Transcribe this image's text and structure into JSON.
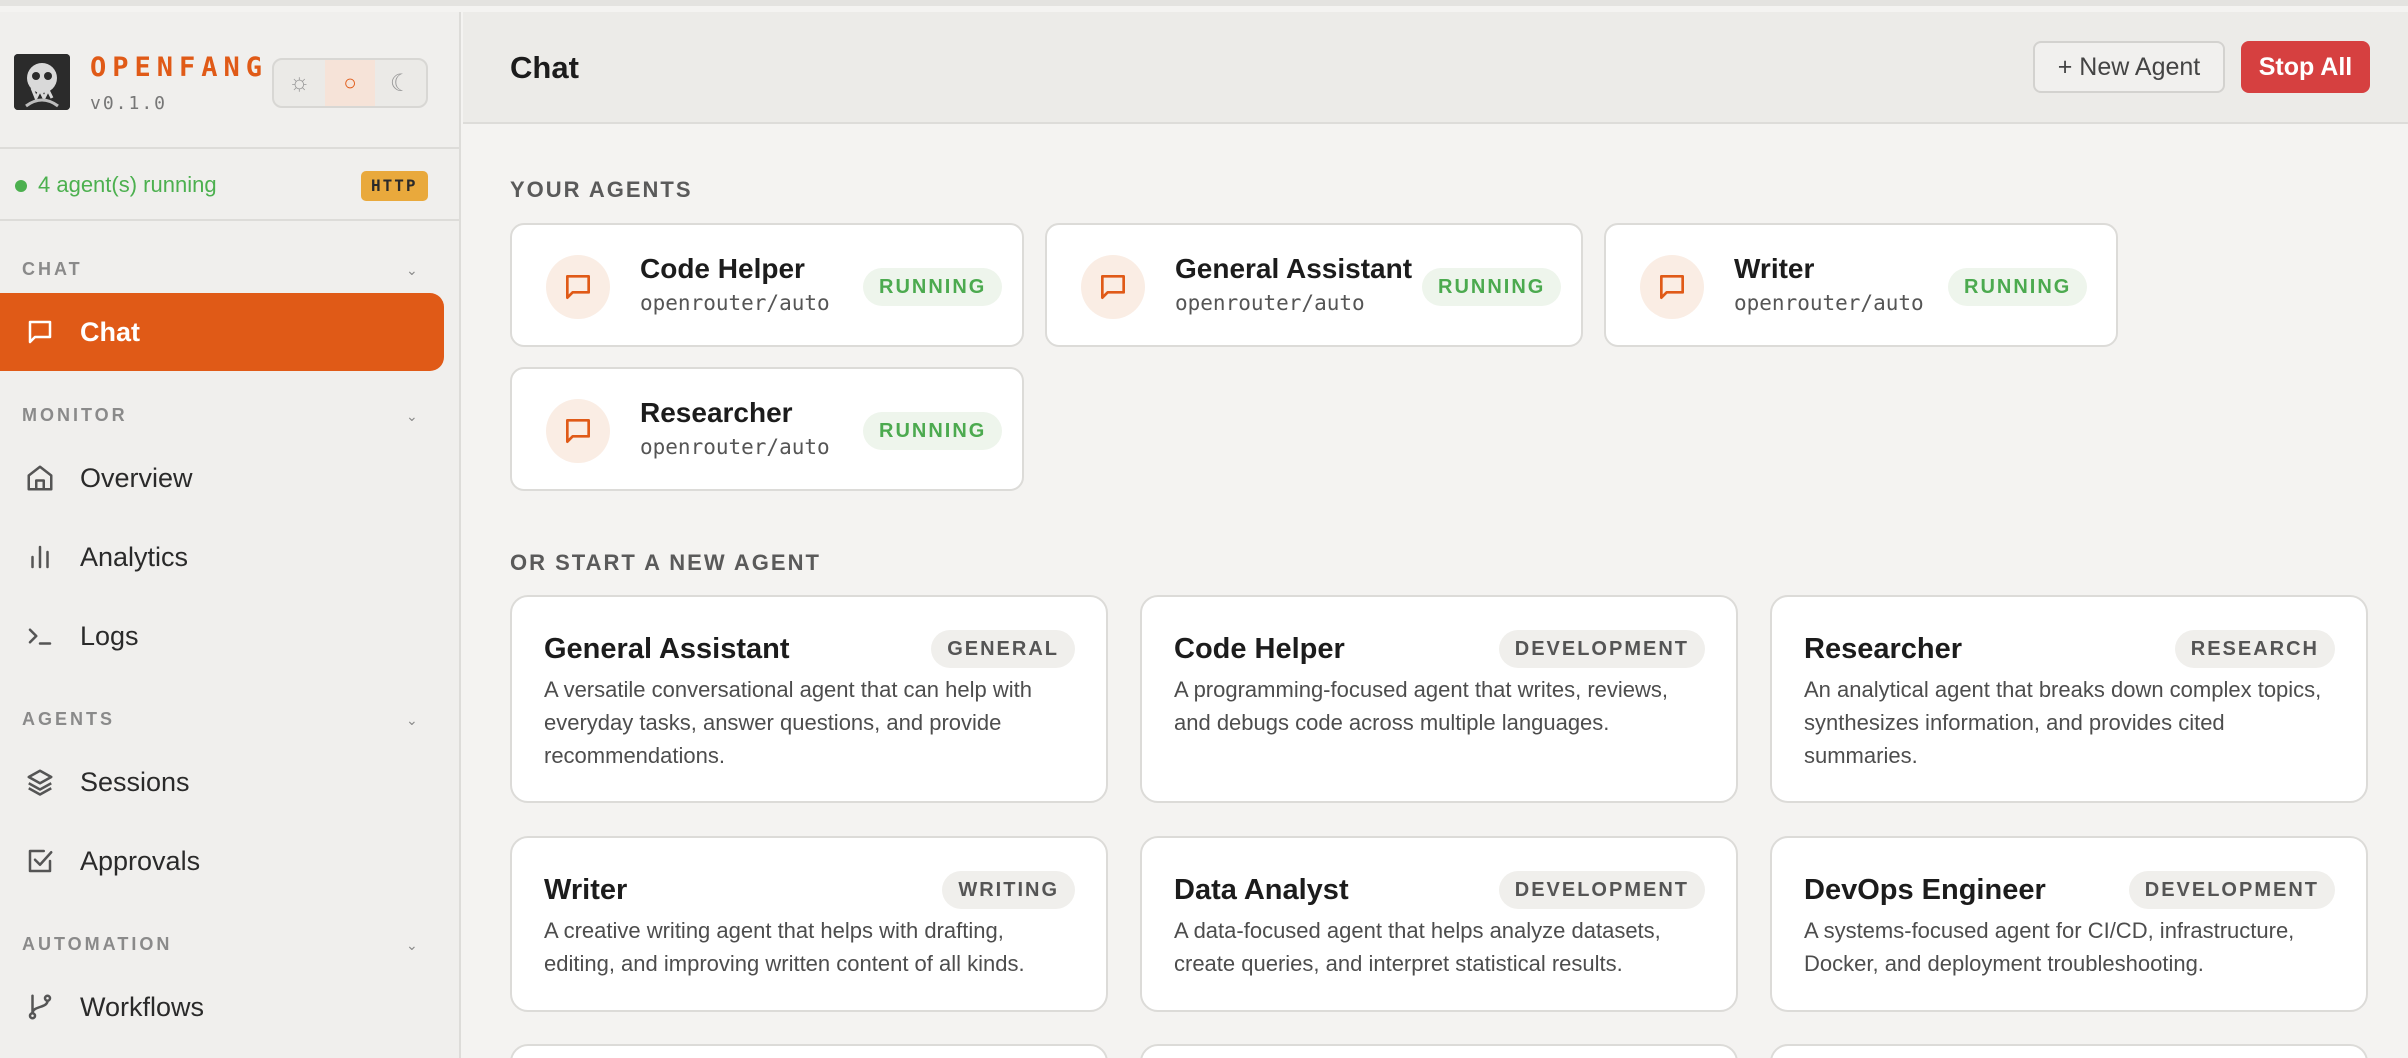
{
  "brand": {
    "name": "OPENFANG",
    "version": "v0.1.0"
  },
  "theme": {
    "light": "☼",
    "system": "○",
    "dark": "☾"
  },
  "status": {
    "text": "4 agent(s) running",
    "badge": "HTTP"
  },
  "sidebar": {
    "sections": [
      {
        "label": "CHAT",
        "items": [
          {
            "label": "Chat",
            "icon": "chat-icon"
          }
        ]
      },
      {
        "label": "MONITOR",
        "items": [
          {
            "label": "Overview",
            "icon": "home-icon"
          },
          {
            "label": "Analytics",
            "icon": "bar-chart-icon"
          },
          {
            "label": "Logs",
            "icon": "terminal-icon"
          }
        ]
      },
      {
        "label": "AGENTS",
        "items": [
          {
            "label": "Sessions",
            "icon": "layers-icon"
          },
          {
            "label": "Approvals",
            "icon": "checkbox-icon"
          }
        ]
      },
      {
        "label": "AUTOMATION",
        "items": [
          {
            "label": "Workflows",
            "icon": "git-branch-icon"
          }
        ]
      }
    ]
  },
  "header": {
    "title": "Chat",
    "new_agent": "+ New Agent",
    "stop_all": "Stop All"
  },
  "your_agents": {
    "heading": "YOUR AGENTS",
    "agents": [
      {
        "name": "Code Helper",
        "model": "openrouter/auto",
        "status": "RUNNING"
      },
      {
        "name": "General Assistant",
        "model": "openrouter/auto",
        "status": "RUNNING"
      },
      {
        "name": "Writer",
        "model": "openrouter/auto",
        "status": "RUNNING"
      },
      {
        "name": "Researcher",
        "model": "openrouter/auto",
        "status": "RUNNING"
      }
    ]
  },
  "templates": {
    "heading": "OR START A NEW AGENT",
    "items": [
      {
        "name": "General Assistant",
        "category": "GENERAL",
        "description": "A versatile conversational agent that can help with everyday tasks, answer questions, and provide recommendations."
      },
      {
        "name": "Code Helper",
        "category": "DEVELOPMENT",
        "description": "A programming-focused agent that writes, reviews, and debugs code across multiple languages."
      },
      {
        "name": "Researcher",
        "category": "RESEARCH",
        "description": "An analytical agent that breaks down complex topics, synthesizes information, and provides cited summaries."
      },
      {
        "name": "Writer",
        "category": "WRITING",
        "description": "A creative writing agent that helps with drafting, editing, and improving written content of all kinds."
      },
      {
        "name": "Data Analyst",
        "category": "DEVELOPMENT",
        "description": "A data-focused agent that helps analyze datasets, create queries, and interpret statistical results."
      },
      {
        "name": "DevOps Engineer",
        "category": "DEVELOPMENT",
        "description": "A systems-focused agent for CI/CD, infrastructure, Docker, and deployment troubleshooting."
      }
    ]
  },
  "colors": {
    "accent": "#e05a17",
    "running": "#4caa4f",
    "danger": "#d64040",
    "http_badge": "#e9a93c"
  }
}
